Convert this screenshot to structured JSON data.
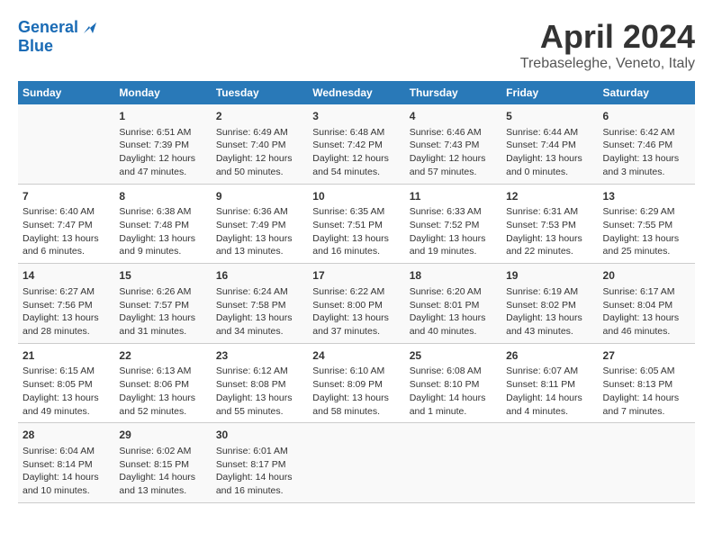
{
  "header": {
    "logo_line1": "General",
    "logo_line2": "Blue",
    "title": "April 2024",
    "subtitle": "Trebaseleghe, Veneto, Italy"
  },
  "weekdays": [
    "Sunday",
    "Monday",
    "Tuesday",
    "Wednesday",
    "Thursday",
    "Friday",
    "Saturday"
  ],
  "weeks": [
    [
      {
        "day": "",
        "info": ""
      },
      {
        "day": "1",
        "info": "Sunrise: 6:51 AM\nSunset: 7:39 PM\nDaylight: 12 hours\nand 47 minutes."
      },
      {
        "day": "2",
        "info": "Sunrise: 6:49 AM\nSunset: 7:40 PM\nDaylight: 12 hours\nand 50 minutes."
      },
      {
        "day": "3",
        "info": "Sunrise: 6:48 AM\nSunset: 7:42 PM\nDaylight: 12 hours\nand 54 minutes."
      },
      {
        "day": "4",
        "info": "Sunrise: 6:46 AM\nSunset: 7:43 PM\nDaylight: 12 hours\nand 57 minutes."
      },
      {
        "day": "5",
        "info": "Sunrise: 6:44 AM\nSunset: 7:44 PM\nDaylight: 13 hours\nand 0 minutes."
      },
      {
        "day": "6",
        "info": "Sunrise: 6:42 AM\nSunset: 7:46 PM\nDaylight: 13 hours\nand 3 minutes."
      }
    ],
    [
      {
        "day": "7",
        "info": "Sunrise: 6:40 AM\nSunset: 7:47 PM\nDaylight: 13 hours\nand 6 minutes."
      },
      {
        "day": "8",
        "info": "Sunrise: 6:38 AM\nSunset: 7:48 PM\nDaylight: 13 hours\nand 9 minutes."
      },
      {
        "day": "9",
        "info": "Sunrise: 6:36 AM\nSunset: 7:49 PM\nDaylight: 13 hours\nand 13 minutes."
      },
      {
        "day": "10",
        "info": "Sunrise: 6:35 AM\nSunset: 7:51 PM\nDaylight: 13 hours\nand 16 minutes."
      },
      {
        "day": "11",
        "info": "Sunrise: 6:33 AM\nSunset: 7:52 PM\nDaylight: 13 hours\nand 19 minutes."
      },
      {
        "day": "12",
        "info": "Sunrise: 6:31 AM\nSunset: 7:53 PM\nDaylight: 13 hours\nand 22 minutes."
      },
      {
        "day": "13",
        "info": "Sunrise: 6:29 AM\nSunset: 7:55 PM\nDaylight: 13 hours\nand 25 minutes."
      }
    ],
    [
      {
        "day": "14",
        "info": "Sunrise: 6:27 AM\nSunset: 7:56 PM\nDaylight: 13 hours\nand 28 minutes."
      },
      {
        "day": "15",
        "info": "Sunrise: 6:26 AM\nSunset: 7:57 PM\nDaylight: 13 hours\nand 31 minutes."
      },
      {
        "day": "16",
        "info": "Sunrise: 6:24 AM\nSunset: 7:58 PM\nDaylight: 13 hours\nand 34 minutes."
      },
      {
        "day": "17",
        "info": "Sunrise: 6:22 AM\nSunset: 8:00 PM\nDaylight: 13 hours\nand 37 minutes."
      },
      {
        "day": "18",
        "info": "Sunrise: 6:20 AM\nSunset: 8:01 PM\nDaylight: 13 hours\nand 40 minutes."
      },
      {
        "day": "19",
        "info": "Sunrise: 6:19 AM\nSunset: 8:02 PM\nDaylight: 13 hours\nand 43 minutes."
      },
      {
        "day": "20",
        "info": "Sunrise: 6:17 AM\nSunset: 8:04 PM\nDaylight: 13 hours\nand 46 minutes."
      }
    ],
    [
      {
        "day": "21",
        "info": "Sunrise: 6:15 AM\nSunset: 8:05 PM\nDaylight: 13 hours\nand 49 minutes."
      },
      {
        "day": "22",
        "info": "Sunrise: 6:13 AM\nSunset: 8:06 PM\nDaylight: 13 hours\nand 52 minutes."
      },
      {
        "day": "23",
        "info": "Sunrise: 6:12 AM\nSunset: 8:08 PM\nDaylight: 13 hours\nand 55 minutes."
      },
      {
        "day": "24",
        "info": "Sunrise: 6:10 AM\nSunset: 8:09 PM\nDaylight: 13 hours\nand 58 minutes."
      },
      {
        "day": "25",
        "info": "Sunrise: 6:08 AM\nSunset: 8:10 PM\nDaylight: 14 hours\nand 1 minute."
      },
      {
        "day": "26",
        "info": "Sunrise: 6:07 AM\nSunset: 8:11 PM\nDaylight: 14 hours\nand 4 minutes."
      },
      {
        "day": "27",
        "info": "Sunrise: 6:05 AM\nSunset: 8:13 PM\nDaylight: 14 hours\nand 7 minutes."
      }
    ],
    [
      {
        "day": "28",
        "info": "Sunrise: 6:04 AM\nSunset: 8:14 PM\nDaylight: 14 hours\nand 10 minutes."
      },
      {
        "day": "29",
        "info": "Sunrise: 6:02 AM\nSunset: 8:15 PM\nDaylight: 14 hours\nand 13 minutes."
      },
      {
        "day": "30",
        "info": "Sunrise: 6:01 AM\nSunset: 8:17 PM\nDaylight: 14 hours\nand 16 minutes."
      },
      {
        "day": "",
        "info": ""
      },
      {
        "day": "",
        "info": ""
      },
      {
        "day": "",
        "info": ""
      },
      {
        "day": "",
        "info": ""
      }
    ]
  ]
}
